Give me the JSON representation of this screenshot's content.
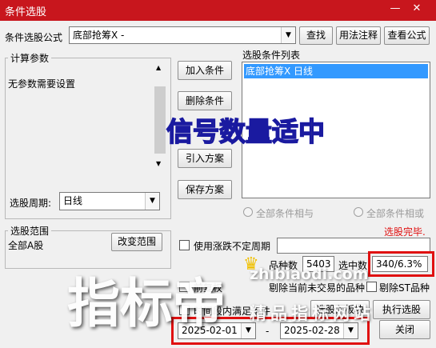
{
  "window": {
    "title": "条件选股",
    "minimize_glyph": "—",
    "close_glyph": "✕"
  },
  "formula": {
    "label": "条件选股公式",
    "value": "底部抢筹X  -",
    "buttons": {
      "find": "查找",
      "usage": "用法注释",
      "view": "查看公式"
    }
  },
  "params": {
    "group_title": "计算参数",
    "none_text": "无参数需要设置",
    "period_label": "选股周期:",
    "period_value": "日线"
  },
  "actions": {
    "add": "加入条件",
    "delete": "删除条件",
    "import": "引入方案",
    "save": "保存方案"
  },
  "conditions": {
    "title": "选股条件列表",
    "items": [
      "底部抢筹X  日线"
    ],
    "and_label": "全部条件相与",
    "or_label": "全部条件相或"
  },
  "status": {
    "done": "选股完毕.",
    "stock_count_label": "品种数",
    "stock_count": "5403",
    "selected_label": "选中数",
    "selected_value": "340/6.3%"
  },
  "range": {
    "group_title": "选股范围",
    "value": "全部A股",
    "change_button": "改变范围"
  },
  "options": {
    "use_limit_period": "使用涨跌不定周期",
    "pre_restore": "前复权",
    "opt2": "剔除当前未交易的品种",
    "opt3": "剔除ST品种",
    "time_range": "时间段内满足条件"
  },
  "dates": {
    "start": "2025-02-01",
    "separator": "-",
    "end": "2025-02-28"
  },
  "bottom_buttons": {
    "to_block": "选股入板块",
    "run": "执行选股",
    "close": "关闭"
  },
  "watermarks": {
    "banner": "信号数量适中",
    "big": "指标帝",
    "site": "zhibiaodi.com",
    "site_cn": "精品指标网站"
  },
  "colors": {
    "title_bg": "#c8161d",
    "selected_bg": "#3399ff",
    "status_red": "#e01010",
    "banner_yellow": "#ffe600",
    "banner_outline": "#1a1aa0"
  }
}
